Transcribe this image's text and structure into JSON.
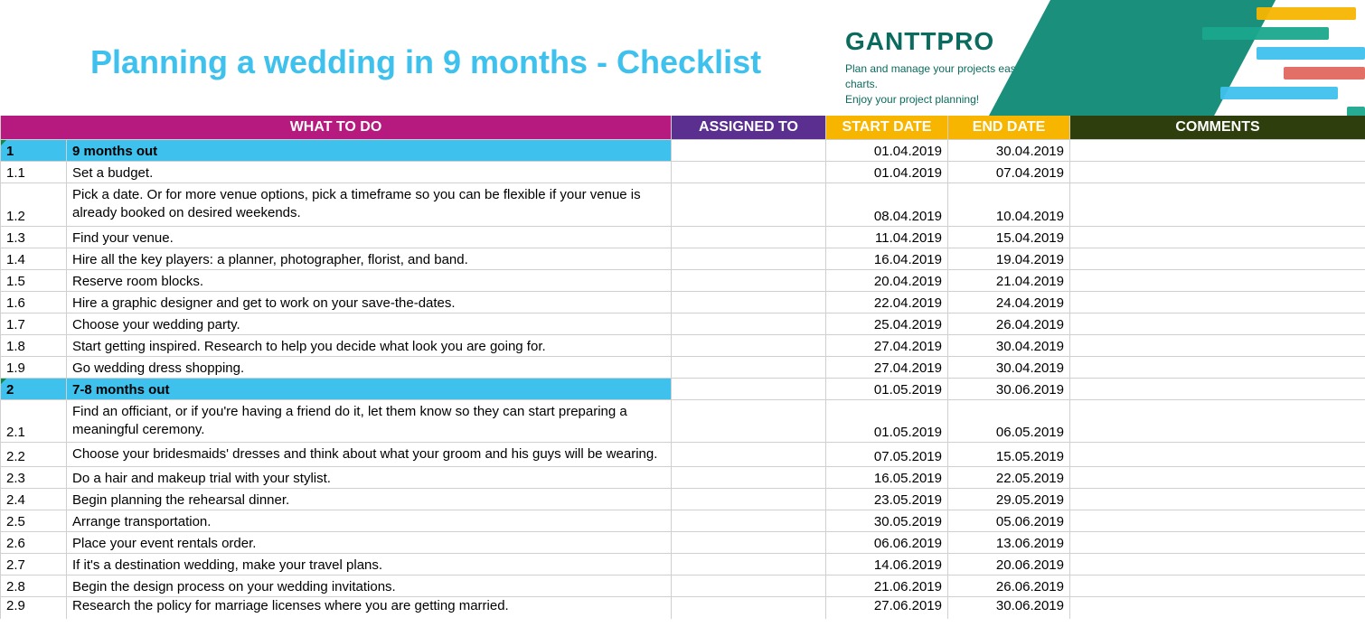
{
  "title": "Planning a wedding in 9 months - Checklist",
  "brand": {
    "logo": "GANTTPRO",
    "tagline1": "Plan and manage your projects easily with Gantt charts.",
    "tagline2": "Enjoy your project planning!"
  },
  "headers": {
    "what": "WHAT TO DO",
    "assigned": "ASSIGNED TO",
    "start": "START DATE",
    "end": "END DATE",
    "comments": "COMMENTS"
  },
  "rows": [
    {
      "num": "1",
      "what": "9 months out",
      "assigned": "",
      "start": "01.04.2019",
      "end": "30.04.2019",
      "comments": "",
      "section": true
    },
    {
      "num": "1.1",
      "what": "Set a budget.",
      "assigned": "",
      "start": "01.04.2019",
      "end": "07.04.2019",
      "comments": ""
    },
    {
      "num": "1.2",
      "what": "Pick a date. Or for more venue options, pick a timeframe so you can be flexible if your venue is already booked on desired weekends.",
      "assigned": "",
      "start": "08.04.2019",
      "end": "10.04.2019",
      "comments": "",
      "wrap": true
    },
    {
      "num": "1.3",
      "what": "Find your venue.",
      "assigned": "",
      "start": "11.04.2019",
      "end": "15.04.2019",
      "comments": ""
    },
    {
      "num": "1.4",
      "what": "Hire all the key players: a planner, photographer, florist, and band.",
      "assigned": "",
      "start": "16.04.2019",
      "end": "19.04.2019",
      "comments": ""
    },
    {
      "num": "1.5",
      "what": "Reserve room blocks.",
      "assigned": "",
      "start": "20.04.2019",
      "end": "21.04.2019",
      "comments": ""
    },
    {
      "num": "1.6",
      "what": "Hire a graphic designer and get to work on your save-the-dates.",
      "assigned": "",
      "start": "22.04.2019",
      "end": "24.04.2019",
      "comments": ""
    },
    {
      "num": "1.7",
      "what": "Choose your wedding party.",
      "assigned": "",
      "start": "25.04.2019",
      "end": "26.04.2019",
      "comments": ""
    },
    {
      "num": "1.8",
      "what": "Start getting inspired. Research to help you decide what look you are going for.",
      "assigned": "",
      "start": "27.04.2019",
      "end": "30.04.2019",
      "comments": ""
    },
    {
      "num": "1.9",
      "what": "Go wedding dress shopping.",
      "assigned": "",
      "start": "27.04.2019",
      "end": "30.04.2019",
      "comments": ""
    },
    {
      "num": "2",
      "what": "7-8 months out",
      "assigned": "",
      "start": "01.05.2019",
      "end": "30.06.2019",
      "comments": "",
      "section": true
    },
    {
      "num": "2.1",
      "what": "Find an officiant, or if you're having a friend do it, let them know so they can start preparing a meaningful ceremony.",
      "assigned": "",
      "start": "01.05.2019",
      "end": "06.05.2019",
      "comments": "",
      "wrap": true
    },
    {
      "num": "2.2",
      "what": "Choose your bridesmaids' dresses and think about what your groom and his guys will be wearing.",
      "assigned": "",
      "start": "07.05.2019",
      "end": "15.05.2019",
      "comments": "",
      "wrap": true
    },
    {
      "num": "2.3",
      "what": "Do a hair and makeup trial with your stylist.",
      "assigned": "",
      "start": "16.05.2019",
      "end": "22.05.2019",
      "comments": ""
    },
    {
      "num": "2.4",
      "what": "Begin planning the rehearsal dinner.",
      "assigned": "",
      "start": "23.05.2019",
      "end": "29.05.2019",
      "comments": ""
    },
    {
      "num": "2.5",
      "what": "Arrange transportation.",
      "assigned": "",
      "start": "30.05.2019",
      "end": "05.06.2019",
      "comments": ""
    },
    {
      "num": "2.6",
      "what": "Place your event rentals order.",
      "assigned": "",
      "start": "06.06.2019",
      "end": "13.06.2019",
      "comments": ""
    },
    {
      "num": "2.7",
      "what": "If it's a destination wedding, make your travel plans.",
      "assigned": "",
      "start": "14.06.2019",
      "end": "20.06.2019",
      "comments": ""
    },
    {
      "num": "2.8",
      "what": "Begin the design process on your wedding invitations.",
      "assigned": "",
      "start": "21.06.2019",
      "end": "26.06.2019",
      "comments": ""
    },
    {
      "num": "2.9",
      "what": "Research the policy for marriage licenses where you are getting married.",
      "assigned": "",
      "start": "27.06.2019",
      "end": "30.06.2019",
      "comments": "",
      "cut": true
    }
  ]
}
